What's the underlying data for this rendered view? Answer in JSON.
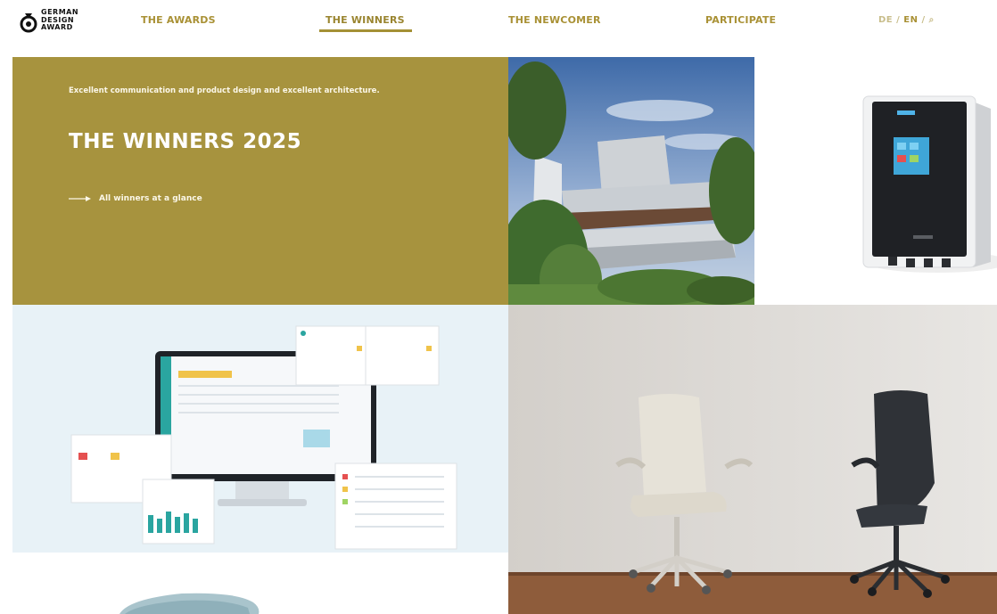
{
  "brand": {
    "logo_lines": [
      "GERMAN",
      "DESIGN",
      "AWARD"
    ]
  },
  "nav": {
    "items": [
      {
        "label": "THE AWARDS"
      },
      {
        "label": "THE WINNERS"
      },
      {
        "label": "THE NEWCOMER"
      },
      {
        "label": "PARTICIPATE"
      }
    ],
    "active": "THE WINNERS"
  },
  "lang": {
    "other": "DE",
    "current": "EN"
  },
  "hero": {
    "kicker": "Excellent communication and product design and excellent architecture.",
    "title": "THE WINNERS 2025",
    "link_label": "All winners at a glance"
  },
  "colors": {
    "accent": "#a7933e",
    "nav_text": "#a99135",
    "software_bg": "#e8f2f7",
    "chairs_bg": "#dcd9d4"
  }
}
